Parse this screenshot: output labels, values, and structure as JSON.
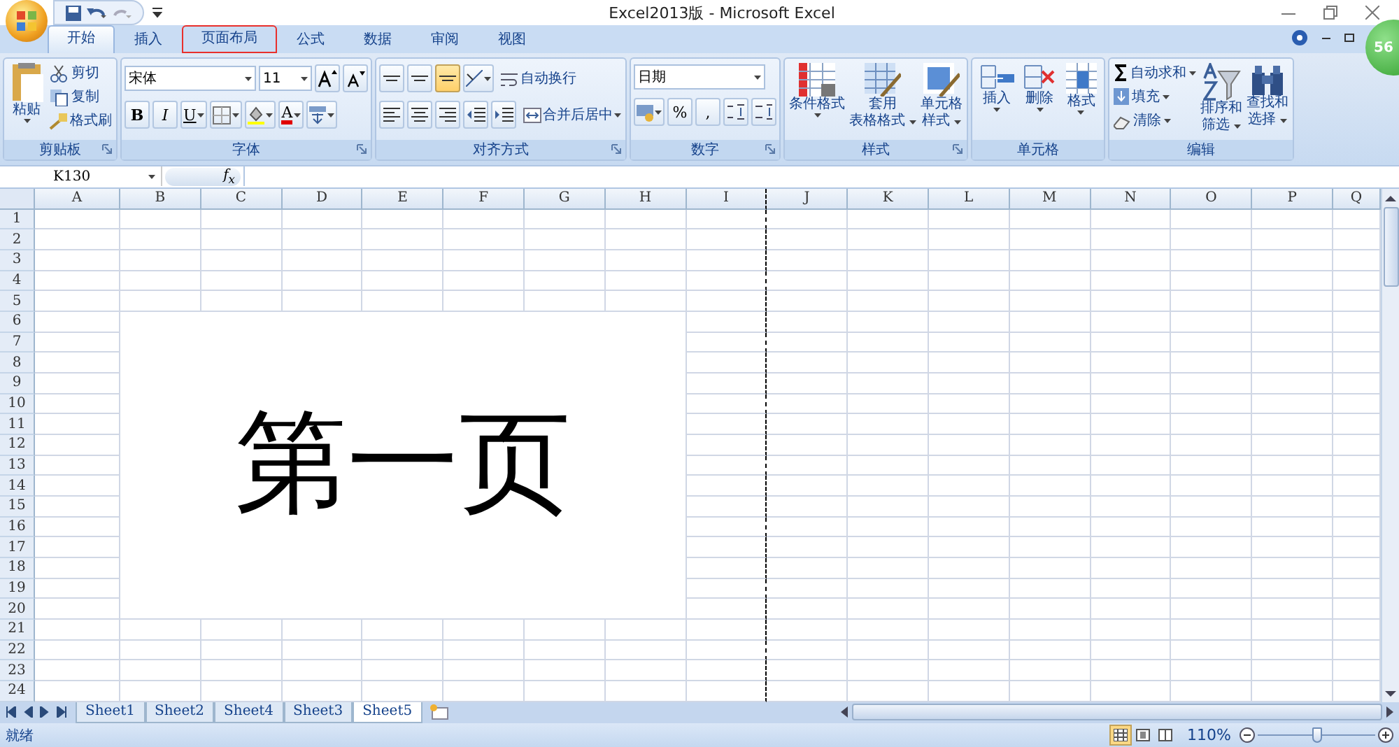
{
  "window": {
    "title": "Excel2013版 - Microsoft Excel",
    "badge": "56"
  },
  "tabs": [
    {
      "label": "开始",
      "selected": true,
      "highlighted": false
    },
    {
      "label": "插入",
      "selected": false,
      "highlighted": false
    },
    {
      "label": "页面布局",
      "selected": false,
      "highlighted": true
    },
    {
      "label": "公式",
      "selected": false,
      "highlighted": false
    },
    {
      "label": "数据",
      "selected": false,
      "highlighted": false
    },
    {
      "label": "审阅",
      "selected": false,
      "highlighted": false
    },
    {
      "label": "视图",
      "selected": false,
      "highlighted": false
    }
  ],
  "ribbon": [
    {
      "title": "剪贴板",
      "launcher": true,
      "items": [
        {
          "kind": "large",
          "lines": [
            "粘贴"
          ],
          "dropdown": true
        },
        {
          "kind": "stack",
          "rows": [
            {
              "label": "剪切",
              "dropdown": false
            },
            {
              "label": "复制",
              "dropdown": false
            },
            {
              "label": "格式刷",
              "dropdown": false
            }
          ]
        }
      ]
    },
    {
      "title": "字体",
      "launcher": true,
      "items": [
        {
          "kind": "panel",
          "rows": [
            [
              {
                "kind": "combo",
                "value": "宋体"
              },
              {
                "kind": "combo",
                "value": "11"
              },
              {
                "kind": "button",
                "selected": false,
                "dropdown": false
              },
              {
                "kind": "button",
                "selected": false,
                "dropdown": false
              }
            ],
            [
              {
                "kind": "button",
                "text": "B",
                "selected": false,
                "dropdown": false
              },
              {
                "kind": "button",
                "text": "I",
                "selected": false,
                "dropdown": false
              },
              {
                "kind": "button",
                "text": "U",
                "selected": false,
                "dropdown": true
              },
              {
                "kind": "button",
                "selected": false,
                "dropdown": true
              },
              {
                "kind": "button",
                "selected": false,
                "dropdown": true
              },
              {
                "kind": "button",
                "text": "A",
                "selected": false,
                "dropdown": true
              },
              {
                "kind": "button",
                "selected": false,
                "dropdown": true
              }
            ]
          ]
        }
      ]
    },
    {
      "title": "对齐方式",
      "launcher": true,
      "items": [
        {
          "kind": "panel",
          "rows": [
            [
              {
                "kind": "button",
                "selected": false,
                "dropdown": false
              },
              {
                "kind": "button",
                "selected": false,
                "dropdown": false
              },
              {
                "kind": "button",
                "selected": true,
                "dropdown": false
              },
              {
                "kind": "button",
                "selected": false,
                "dropdown": true
              },
              {
                "kind": "labeled",
                "label": "自动换行",
                "dropdown": false
              }
            ],
            [
              {
                "kind": "button",
                "selected": false,
                "dropdown": false
              },
              {
                "kind": "button",
                "selected": false,
                "dropdown": false
              },
              {
                "kind": "button",
                "selected": false,
                "dropdown": false
              },
              {
                "kind": "button",
                "selected": false,
                "dropdown": false
              },
              {
                "kind": "button",
                "selected": false,
                "dropdown": false
              },
              {
                "kind": "labeled",
                "label": "合并后居中",
                "dropdown": true
              }
            ]
          ]
        }
      ]
    },
    {
      "title": "数字",
      "launcher": true,
      "items": [
        {
          "kind": "panel",
          "rows": [
            [
              {
                "kind": "combo",
                "value": "日期"
              }
            ],
            [
              {
                "kind": "button",
                "selected": false,
                "dropdown": true
              },
              {
                "kind": "button",
                "text": "%",
                "selected": false,
                "dropdown": false
              },
              {
                "kind": "button",
                "text": ",",
                "selected": false,
                "dropdown": false
              },
              {
                "kind": "button",
                "selected": false,
                "dropdown": false
              },
              {
                "kind": "button",
                "selected": false,
                "dropdown": false
              }
            ]
          ]
        }
      ]
    },
    {
      "title": "样式",
      "launcher": true,
      "items": [
        {
          "kind": "large",
          "lines": [
            "条件格式"
          ],
          "dropdown": true
        },
        {
          "kind": "large",
          "lines": [
            "套用",
            "表格格式"
          ],
          "dropdown": true
        },
        {
          "kind": "large",
          "lines": [
            "单元格",
            "样式"
          ],
          "dropdown": true
        }
      ]
    },
    {
      "title": "单元格",
      "launcher": false,
      "items": [
        {
          "kind": "large",
          "lines": [
            "插入"
          ],
          "dropdown": true
        },
        {
          "kind": "large",
          "lines": [
            "删除"
          ],
          "dropdown": true
        },
        {
          "kind": "large",
          "lines": [
            "格式"
          ],
          "dropdown": true
        }
      ]
    },
    {
      "title": "编辑",
      "launcher": false,
      "items": [
        {
          "kind": "stack",
          "rows": [
            {
              "label": "自动求和",
              "dropdown": true
            },
            {
              "label": "填充",
              "dropdown": true
            },
            {
              "label": "清除",
              "dropdown": true
            }
          ]
        },
        {
          "kind": "large",
          "lines": [
            "排序和",
            "筛选"
          ],
          "dropdown": true
        },
        {
          "kind": "large",
          "lines": [
            "查找和",
            "选择"
          ],
          "dropdown": true
        }
      ]
    }
  ],
  "formula_bar": {
    "name_box": "K130",
    "fx": "f$_{x}$"
  },
  "columns": [
    {
      "label": "A",
      "page_break": false
    },
    {
      "label": "B",
      "page_break": false
    },
    {
      "label": "C",
      "page_break": false
    },
    {
      "label": "D",
      "page_break": false
    },
    {
      "label": "E",
      "page_break": false
    },
    {
      "label": "F",
      "page_break": false
    },
    {
      "label": "G",
      "page_break": false
    },
    {
      "label": "H",
      "page_break": false
    },
    {
      "label": "I",
      "page_break": true
    },
    {
      "label": "J",
      "page_break": false
    },
    {
      "label": "K",
      "page_break": false
    },
    {
      "label": "L",
      "page_break": false
    },
    {
      "label": "M",
      "page_break": false
    },
    {
      "label": "N",
      "page_break": false
    },
    {
      "label": "O",
      "page_break": false
    },
    {
      "label": "P",
      "page_break": false
    },
    {
      "label": "Q",
      "page_break": false
    }
  ],
  "rows": [
    "1",
    "2",
    "3",
    "4",
    "5",
    "6",
    "7",
    "8",
    "9",
    "10",
    "11",
    "12",
    "13",
    "14",
    "15",
    "16",
    "17",
    "18",
    "19",
    "20",
    "21",
    "22",
    "23",
    "24"
  ],
  "merged_cell": {
    "text": "第一页"
  },
  "sheet_tabs": [
    {
      "label": "Sheet1",
      "selected": false
    },
    {
      "label": "Sheet2",
      "selected": false
    },
    {
      "label": "Sheet4",
      "selected": false
    },
    {
      "label": "Sheet3",
      "selected": false
    },
    {
      "label": "Sheet5",
      "selected": true
    }
  ],
  "status_bar": {
    "text": "就绪",
    "views": [
      {
        "kind": "normal",
        "selected": true
      },
      {
        "kind": "layout",
        "selected": false
      },
      {
        "kind": "pagebreak",
        "selected": false
      }
    ],
    "zoom": "110%",
    "zoom_level": {
      "level": 0.5
    }
  }
}
